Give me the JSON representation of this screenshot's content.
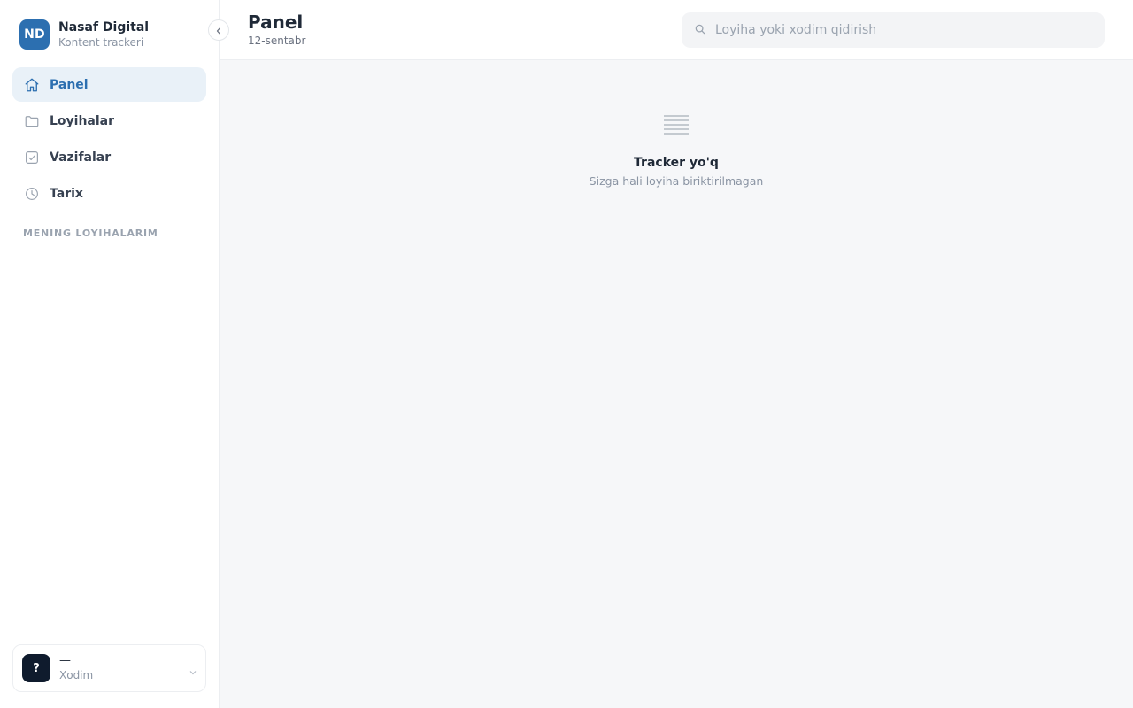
{
  "brand": {
    "initials": "ND",
    "name": "Nasaf Digital",
    "subtitle": "Kontent trackeri"
  },
  "sidebar": {
    "items": [
      {
        "label": "Panel",
        "icon": "home-icon",
        "active": true
      },
      {
        "label": "Loyihalar",
        "icon": "folder-icon",
        "active": false
      },
      {
        "label": "Vazifalar",
        "icon": "checkbox-icon",
        "active": false
      },
      {
        "label": "Tarix",
        "icon": "clock-icon",
        "active": false
      }
    ],
    "section_title": "MENING LOYIHALARIM"
  },
  "user": {
    "avatar": "?",
    "name": "—",
    "role": "Xodim"
  },
  "header": {
    "title": "Panel",
    "date": "12-sentabr",
    "search_placeholder": "Loyiha yoki xodim qidirish"
  },
  "empty_state": {
    "icon": "list-lines-icon",
    "title": "Tracker yo'q",
    "subtitle": "Sizga hali loyiha biriktirilmagan"
  },
  "colors": {
    "accent": "#2c6fb0",
    "active_bg": "#e9f1f8",
    "avatar_dark": "#0f1b2d"
  }
}
